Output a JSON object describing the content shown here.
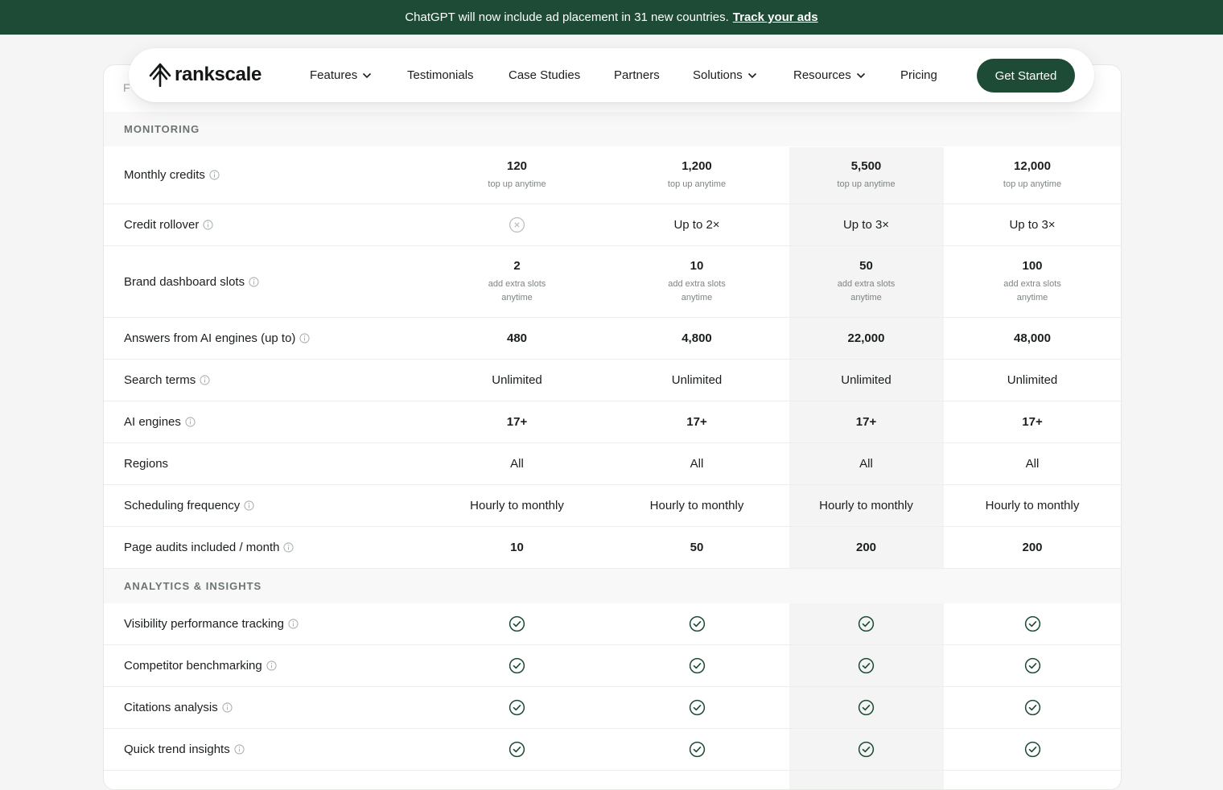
{
  "banner": {
    "text": "ChatGPT will now include ad placement in 31 new countries.",
    "link": "Track your ads"
  },
  "nav": {
    "logo": "rankscale",
    "items": [
      "Features",
      "Testimonials",
      "Case Studies",
      "Partners",
      "Solutions",
      "Resources",
      "Pricing"
    ],
    "cta": "Get Started"
  },
  "table": {
    "peek_text": "F",
    "sections": [
      {
        "title": "MONITORING",
        "rows": [
          {
            "label": "Monthly credits",
            "info": true,
            "type": "main-sub",
            "values": [
              "120",
              "1,200",
              "5,500",
              "12,000"
            ],
            "subs": [
              "top up anytime",
              "top up anytime",
              "top up anytime",
              "top up anytime"
            ]
          },
          {
            "label": "Credit rollover",
            "info": true,
            "type": "mixed",
            "values": [
              "x",
              "Up to 2×",
              "Up to 3×",
              "Up to 3×"
            ]
          },
          {
            "label": "Brand dashboard slots",
            "info": true,
            "type": "main-sub",
            "values": [
              "2",
              "10",
              "50",
              "100"
            ],
            "subs": [
              "add extra slots anytime",
              "add extra slots anytime",
              "add extra slots anytime",
              "add extra slots anytime"
            ]
          },
          {
            "label": "Answers from AI engines (up to)",
            "info": true,
            "type": "bold",
            "values": [
              "480",
              "4,800",
              "22,000",
              "48,000"
            ]
          },
          {
            "label": "Search terms",
            "info": true,
            "type": "plain",
            "values": [
              "Unlimited",
              "Unlimited",
              "Unlimited",
              "Unlimited"
            ]
          },
          {
            "label": "AI engines",
            "info": true,
            "type": "bold",
            "values": [
              "17+",
              "17+",
              "17+",
              "17+"
            ]
          },
          {
            "label": "Regions",
            "info": false,
            "type": "plain",
            "values": [
              "All",
              "All",
              "All",
              "All"
            ]
          },
          {
            "label": "Scheduling frequency",
            "info": true,
            "type": "plain",
            "values": [
              "Hourly to monthly",
              "Hourly to monthly",
              "Hourly to monthly",
              "Hourly to monthly"
            ]
          },
          {
            "label": "Page audits included / month",
            "info": true,
            "type": "bold",
            "values": [
              "10",
              "50",
              "200",
              "200"
            ]
          }
        ]
      },
      {
        "title": "ANALYTICS & INSIGHTS",
        "rows": [
          {
            "label": "Visibility performance tracking",
            "info": true,
            "type": "check",
            "values": [
              "check",
              "check",
              "check",
              "check"
            ]
          },
          {
            "label": "Competitor benchmarking",
            "info": true,
            "type": "check",
            "values": [
              "check",
              "check",
              "check",
              "check"
            ]
          },
          {
            "label": "Citations analysis",
            "info": true,
            "type": "check",
            "values": [
              "check",
              "check",
              "check",
              "check"
            ]
          },
          {
            "label": "Quick trend insights",
            "info": true,
            "type": "check",
            "values": [
              "check",
              "check",
              "check",
              "check"
            ]
          }
        ]
      }
    ]
  },
  "colors": {
    "brand_green": "#1d4b35",
    "highlight_column": "#f3f4f3",
    "section_bg": "#f7f8f7"
  }
}
